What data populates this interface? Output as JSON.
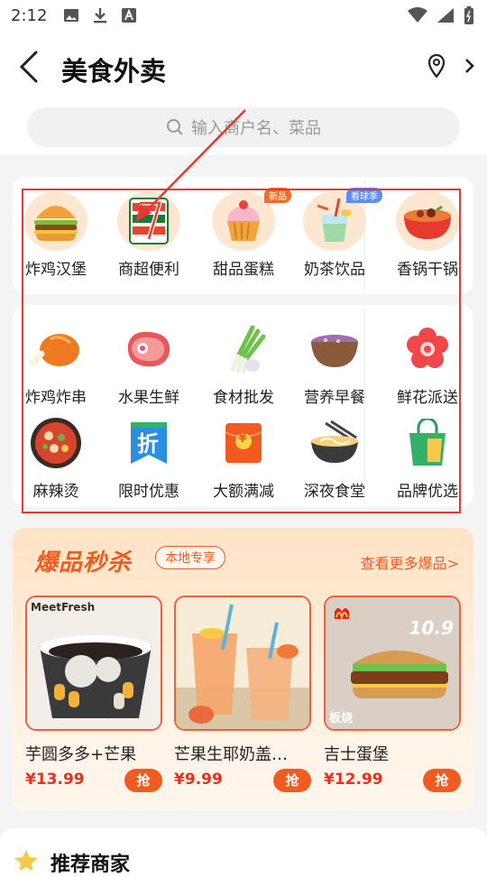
{
  "status": {
    "time": "2:12"
  },
  "header": {
    "title": "美食外卖"
  },
  "search": {
    "placeholder": "输入商户名、菜品"
  },
  "categories_row1": [
    {
      "label": "炸鸡汉堡",
      "icon": "burger-icon"
    },
    {
      "label": "商超便利",
      "icon": "seven-eleven-icon"
    },
    {
      "label": "甜品蛋糕",
      "icon": "cupcake-icon",
      "badge": "新品"
    },
    {
      "label": "奶茶饮品",
      "icon": "drink-icon",
      "badge": "看球季"
    },
    {
      "label": "香锅干锅",
      "icon": "hotpot-icon"
    }
  ],
  "categories_row2": [
    {
      "label": "炸鸡炸串",
      "icon": "fried-chicken-icon"
    },
    {
      "label": "水果生鲜",
      "icon": "steak-icon"
    },
    {
      "label": "食材批发",
      "icon": "scallion-icon"
    },
    {
      "label": "营养早餐",
      "icon": "bowl-icon"
    },
    {
      "label": "鲜花派送",
      "icon": "flower-icon"
    }
  ],
  "categories_row3": [
    {
      "label": "麻辣烫",
      "icon": "spicy-bowl-icon"
    },
    {
      "label": "限时优惠",
      "icon": "discount-icon",
      "glyph": "折"
    },
    {
      "label": "大额满减",
      "icon": "coupon-icon",
      "glyph": "¥"
    },
    {
      "label": "深夜食堂",
      "icon": "noodle-icon"
    },
    {
      "label": "品牌优选",
      "icon": "shopping-bag-icon"
    }
  ],
  "flash": {
    "title": "爆品秒杀",
    "tag": "本地专享",
    "more": "查看更多爆品>"
  },
  "products": [
    {
      "name": "芋圆多多+芒果",
      "price": "¥13.99",
      "grab": "抢",
      "brand": "MeetFresh"
    },
    {
      "name": "芒果生耶奶盖…",
      "price": "¥9.99",
      "grab": "抢"
    },
    {
      "name": "吉士蛋堡",
      "price": "¥12.99",
      "grab": "抢",
      "ad_price": "10.9",
      "ad_text": "板烧"
    }
  ],
  "recommend": {
    "title": "推荐商家"
  },
  "colors": {
    "accent": "#f25b1f",
    "highlight": "#e53935"
  }
}
